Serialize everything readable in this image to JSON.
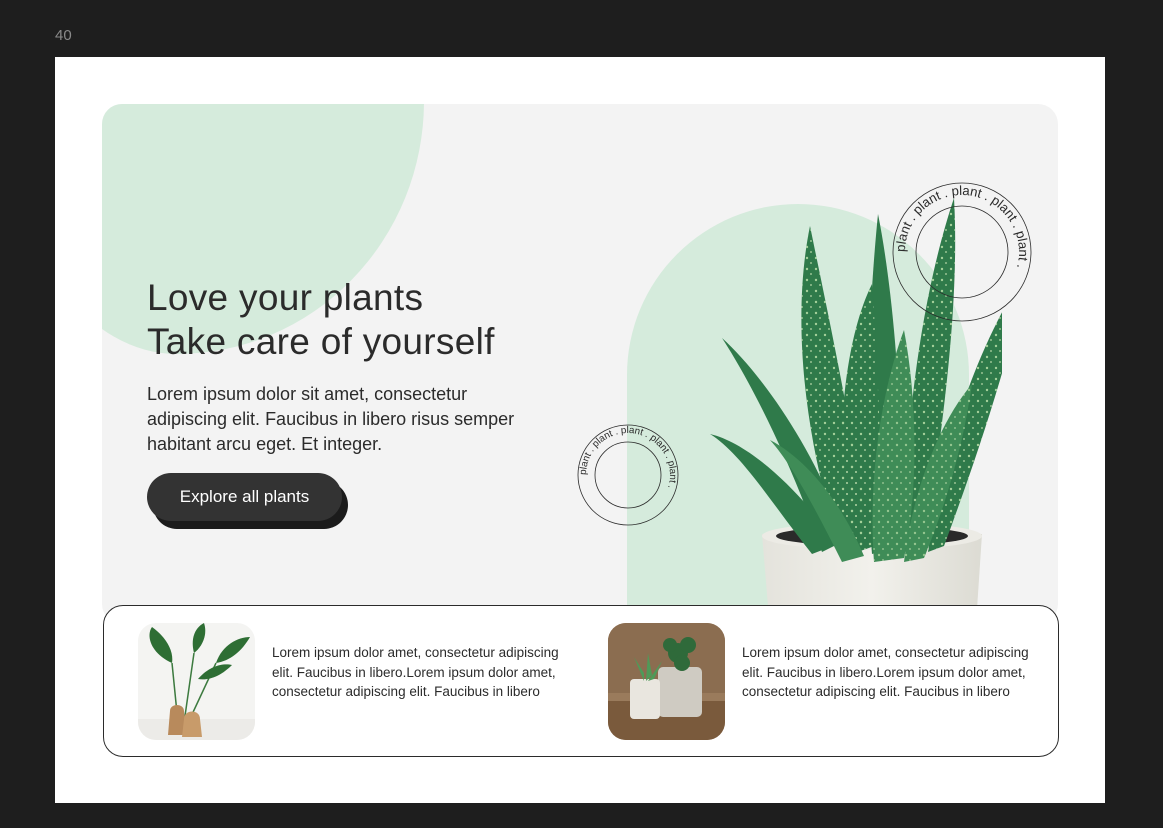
{
  "frame": {
    "label": "40"
  },
  "hero": {
    "headline_line1": "Love your plants",
    "headline_line2": "Take care of yourself",
    "body": "Lorem ipsum dolor sit amet, consectetur adipiscing elit. Faucibus in libero risus semper habitant arcu eget. Et integer.",
    "cta_label": "Explore all plants",
    "stamp_text": "plant . plant . plant . plant . plant . ",
    "image": "aloe-plant-in-white-concrete-pot"
  },
  "products": [
    {
      "image": "bird-of-paradise-cuttings-in-wooden-vases",
      "text": "Lorem ipsum dolor amet, consectetur adipiscing elit. Faucibus in libero.Lorem ipsum dolor amet, consectetur adipiscing elit. Faucibus in libero"
    },
    {
      "image": "succulents-in-concrete-pots",
      "text": "Lorem ipsum dolor amet, consectetur adipiscing elit. Faucibus in libero.Lorem ipsum dolor amet, consectetur adipiscing elit. Faucibus in libero"
    }
  ],
  "colors": {
    "canvas": "#1e1e1e",
    "artboard": "#ffffff",
    "hero_bg": "#f3f3f3",
    "mint": "#d5ebdc",
    "text": "#2b2b2b",
    "button": "#333333",
    "leaf": "#2f7a4a"
  }
}
